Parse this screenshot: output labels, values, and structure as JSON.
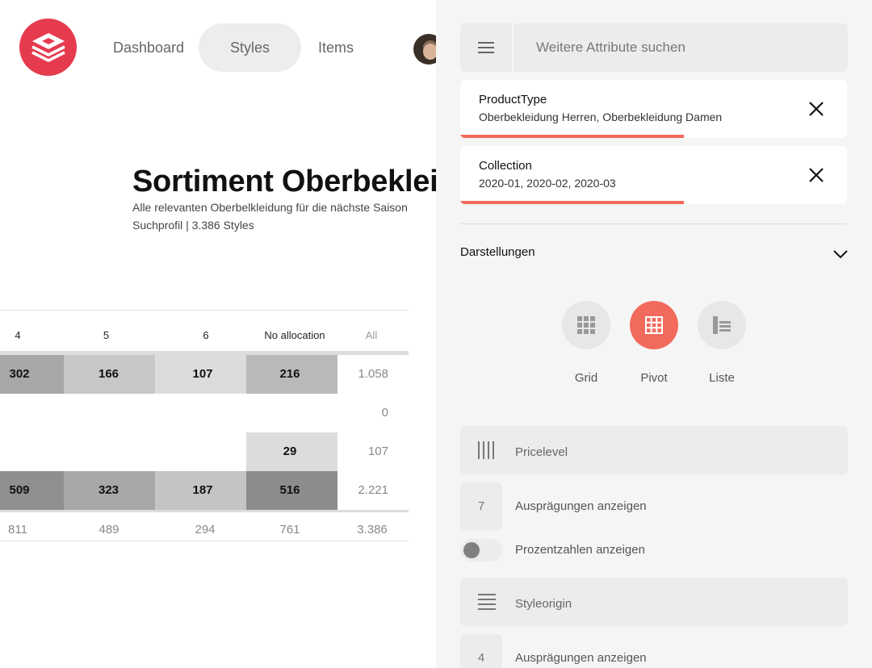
{
  "nav": {
    "items": [
      {
        "label": "Dashboard"
      },
      {
        "label": "Styles"
      },
      {
        "label": "Items"
      }
    ],
    "active": "Styles"
  },
  "page": {
    "title": "Sortiment Oberbekleidung",
    "subtitle": "Alle relevanten Oberbelkleidung für die nächste Saison",
    "meta": "Suchprofil | 3.386 Styles"
  },
  "table": {
    "headers": [
      "4",
      "5",
      "6",
      "No allocation",
      "All"
    ],
    "rows": [
      [
        "302",
        "166",
        "107",
        "216",
        "1.058"
      ],
      [
        "",
        "",
        "",
        "",
        "0"
      ],
      [
        "",
        "",
        "",
        "29",
        "107"
      ],
      [
        "509",
        "323",
        "187",
        "516",
        "2.221"
      ]
    ],
    "footer": [
      "811",
      "489",
      "294",
      "761",
      "3.386"
    ],
    "heat_colors": [
      [
        "#a7a7a7",
        "#c7c7c7",
        "#dcdcdc",
        "#b9b9b9"
      ],
      [
        "",
        "",
        "",
        ""
      ],
      [
        "",
        "",
        "",
        "#dcdcdc"
      ],
      [
        "#8f8f8f",
        "#a8a8a8",
        "#c4c4c4",
        "#8c8c8c"
      ]
    ]
  },
  "panel": {
    "search_placeholder": "Weitere Attribute suchen",
    "filters": [
      {
        "name": "ProductType",
        "values": "Oberbekleidung Herren, Oberbekleidung Damen"
      },
      {
        "name": "Collection",
        "values": "2020-01, 2020-02, 2020-03"
      }
    ],
    "section_title": "Darstellungen",
    "views": [
      {
        "label": "Grid",
        "icon": "grid-icon"
      },
      {
        "label": "Pivot",
        "icon": "pivot-icon",
        "active": true
      },
      {
        "label": "Liste",
        "icon": "list-icon"
      }
    ],
    "attributes": [
      {
        "name": "Pricelevel",
        "icon": "columns-icon",
        "count": "7",
        "count_label": "Ausprägungen anzeigen",
        "toggle_label": "Prozentzahlen anzeigen"
      },
      {
        "name": "Styleorigin",
        "icon": "rows-icon",
        "count": "4",
        "count_label": "Ausprägungen anzeigen"
      }
    ]
  },
  "colors": {
    "brand": "#e63b4f",
    "accent": "#f26a5b"
  }
}
